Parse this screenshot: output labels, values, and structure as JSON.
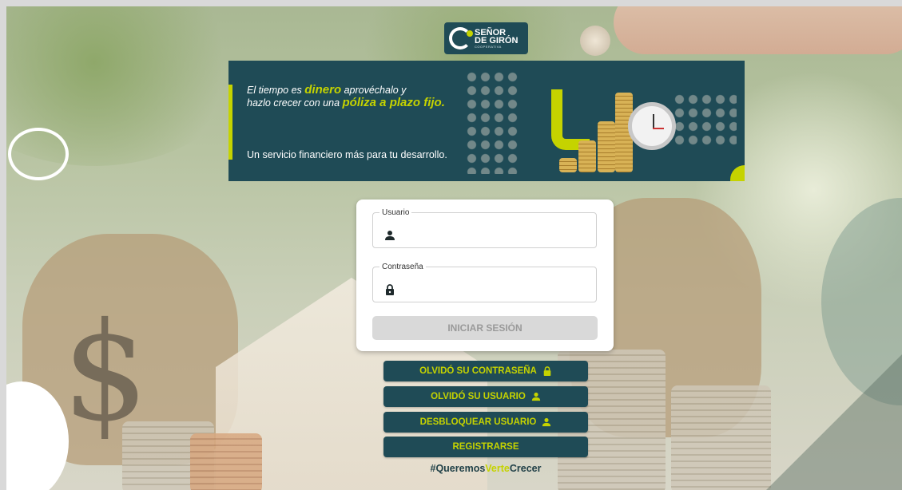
{
  "logo": {
    "line1": "SEÑOR",
    "line2": "DE GIRÓN",
    "line3": "COOPERATIVA"
  },
  "banner": {
    "text1_a": "El tiempo es ",
    "text1_b": "dinero",
    "text1_c": " aprovéchalo y",
    "text2_a": "hazlo crecer con una ",
    "text2_b": "póliza a plazo fijo.",
    "service": "Un servicio financiero más para tu desarrollo."
  },
  "login": {
    "user_label": "Usuario",
    "user_value": "",
    "password_label": "Contraseña",
    "password_value": "",
    "submit_label": "INICIAR SESIÓN"
  },
  "actions": {
    "forgot_password": "OLVIDÓ SU CONTRASEÑA",
    "forgot_user": "OLVIDÓ SU USUARIO",
    "unlock_user": "DESBLOQUEAR USUARIO",
    "register": "REGISTRARSE"
  },
  "hashtag": {
    "part1": "#Queremos",
    "part2": "Verte",
    "part3": "Crecer"
  },
  "colors": {
    "brand_dark": "#1f4b56",
    "brand_accent": "#c5d300"
  },
  "icons": {
    "user_field": "user-icon",
    "password_field": "lock-icon",
    "forgot_password": "lock-icon",
    "forgot_user": "user-icon",
    "unlock_user": "user-icon"
  }
}
